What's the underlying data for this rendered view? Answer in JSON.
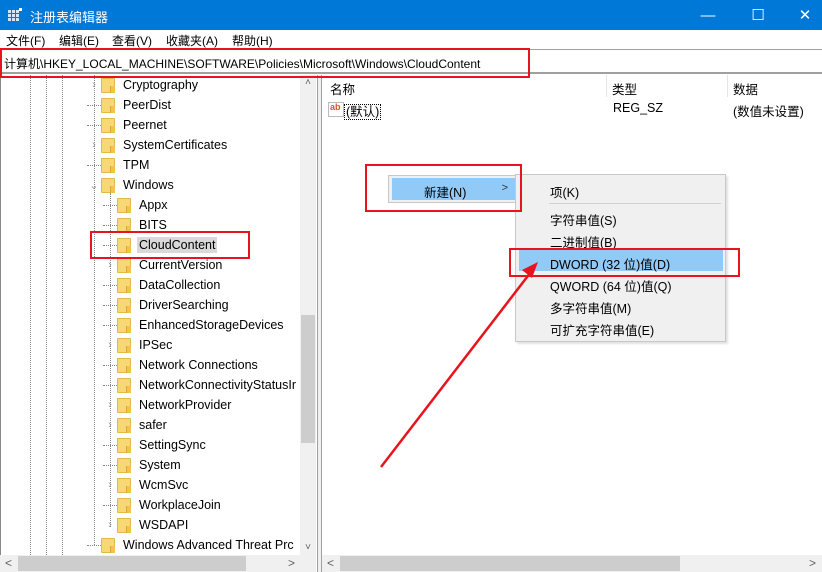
{
  "window": {
    "title": "注册表编辑器",
    "app_icon": "regedit-icon",
    "controls": {
      "minimize": "—",
      "maximize": "☐",
      "close": "✕"
    }
  },
  "menubar": {
    "items": [
      {
        "label": "文件(F)"
      },
      {
        "label": "编辑(E)"
      },
      {
        "label": "查看(V)"
      },
      {
        "label": "收藏夹(A)"
      },
      {
        "label": "帮助(H)"
      }
    ]
  },
  "address": {
    "path": "计算机\\HKEY_LOCAL_MACHINE\\SOFTWARE\\Policies\\Microsoft\\Windows\\CloudContent"
  },
  "tree": {
    "items": [
      {
        "label": "Cryptography",
        "level": 1,
        "expander": ">"
      },
      {
        "label": "PeerDist",
        "level": 1,
        "expander": ""
      },
      {
        "label": "Peernet",
        "level": 1,
        "expander": ""
      },
      {
        "label": "SystemCertificates",
        "level": 1,
        "expander": ">"
      },
      {
        "label": "TPM",
        "level": 1,
        "expander": ""
      },
      {
        "label": "Windows",
        "level": 1,
        "expander": "v"
      },
      {
        "label": "Appx",
        "level": 2,
        "expander": ""
      },
      {
        "label": "BITS",
        "level": 2,
        "expander": ""
      },
      {
        "label": "CloudContent",
        "level": 2,
        "expander": "",
        "selected": true
      },
      {
        "label": "CurrentVersion",
        "level": 2,
        "expander": ">"
      },
      {
        "label": "DataCollection",
        "level": 2,
        "expander": ""
      },
      {
        "label": "DriverSearching",
        "level": 2,
        "expander": ""
      },
      {
        "label": "EnhancedStorageDevices",
        "level": 2,
        "expander": ""
      },
      {
        "label": "IPSec",
        "level": 2,
        "expander": ">"
      },
      {
        "label": "Network Connections",
        "level": 2,
        "expander": ""
      },
      {
        "label": "NetworkConnectivityStatusIr",
        "level": 2,
        "expander": ""
      },
      {
        "label": "NetworkProvider",
        "level": 2,
        "expander": ">"
      },
      {
        "label": "safer",
        "level": 2,
        "expander": ">"
      },
      {
        "label": "SettingSync",
        "level": 2,
        "expander": ""
      },
      {
        "label": "System",
        "level": 2,
        "expander": ""
      },
      {
        "label": "WcmSvc",
        "level": 2,
        "expander": ">"
      },
      {
        "label": "WorkplaceJoin",
        "level": 2,
        "expander": ""
      },
      {
        "label": "WSDAPI",
        "level": 2,
        "expander": ">"
      },
      {
        "label": "Windows Advanced Threat Prc",
        "level": 1,
        "expander": ""
      }
    ]
  },
  "list": {
    "columns": [
      "名称",
      "类型",
      "数据"
    ],
    "rows": [
      {
        "name": "(默认)",
        "type": "REG_SZ",
        "data": "(数值未设置)",
        "icon": "string-value-icon",
        "icon_text": "ab"
      }
    ]
  },
  "context_menu": {
    "new_label": "新建(N)",
    "new_chevron": ">",
    "submenu": [
      {
        "label": "项(K)"
      },
      {
        "label": "字符串值(S)"
      },
      {
        "label": "二进制值(B)"
      },
      {
        "label": "DWORD (32 位)值(D)",
        "highlighted": true
      },
      {
        "label": "QWORD (64 位)值(Q)"
      },
      {
        "label": "多字符串值(M)"
      },
      {
        "label": "可扩充字符串值(E)"
      }
    ]
  },
  "scroll": {
    "up": "˄",
    "down": "˅",
    "left": "<",
    "right": ">"
  },
  "annotation": {
    "color": "#e8141d"
  }
}
